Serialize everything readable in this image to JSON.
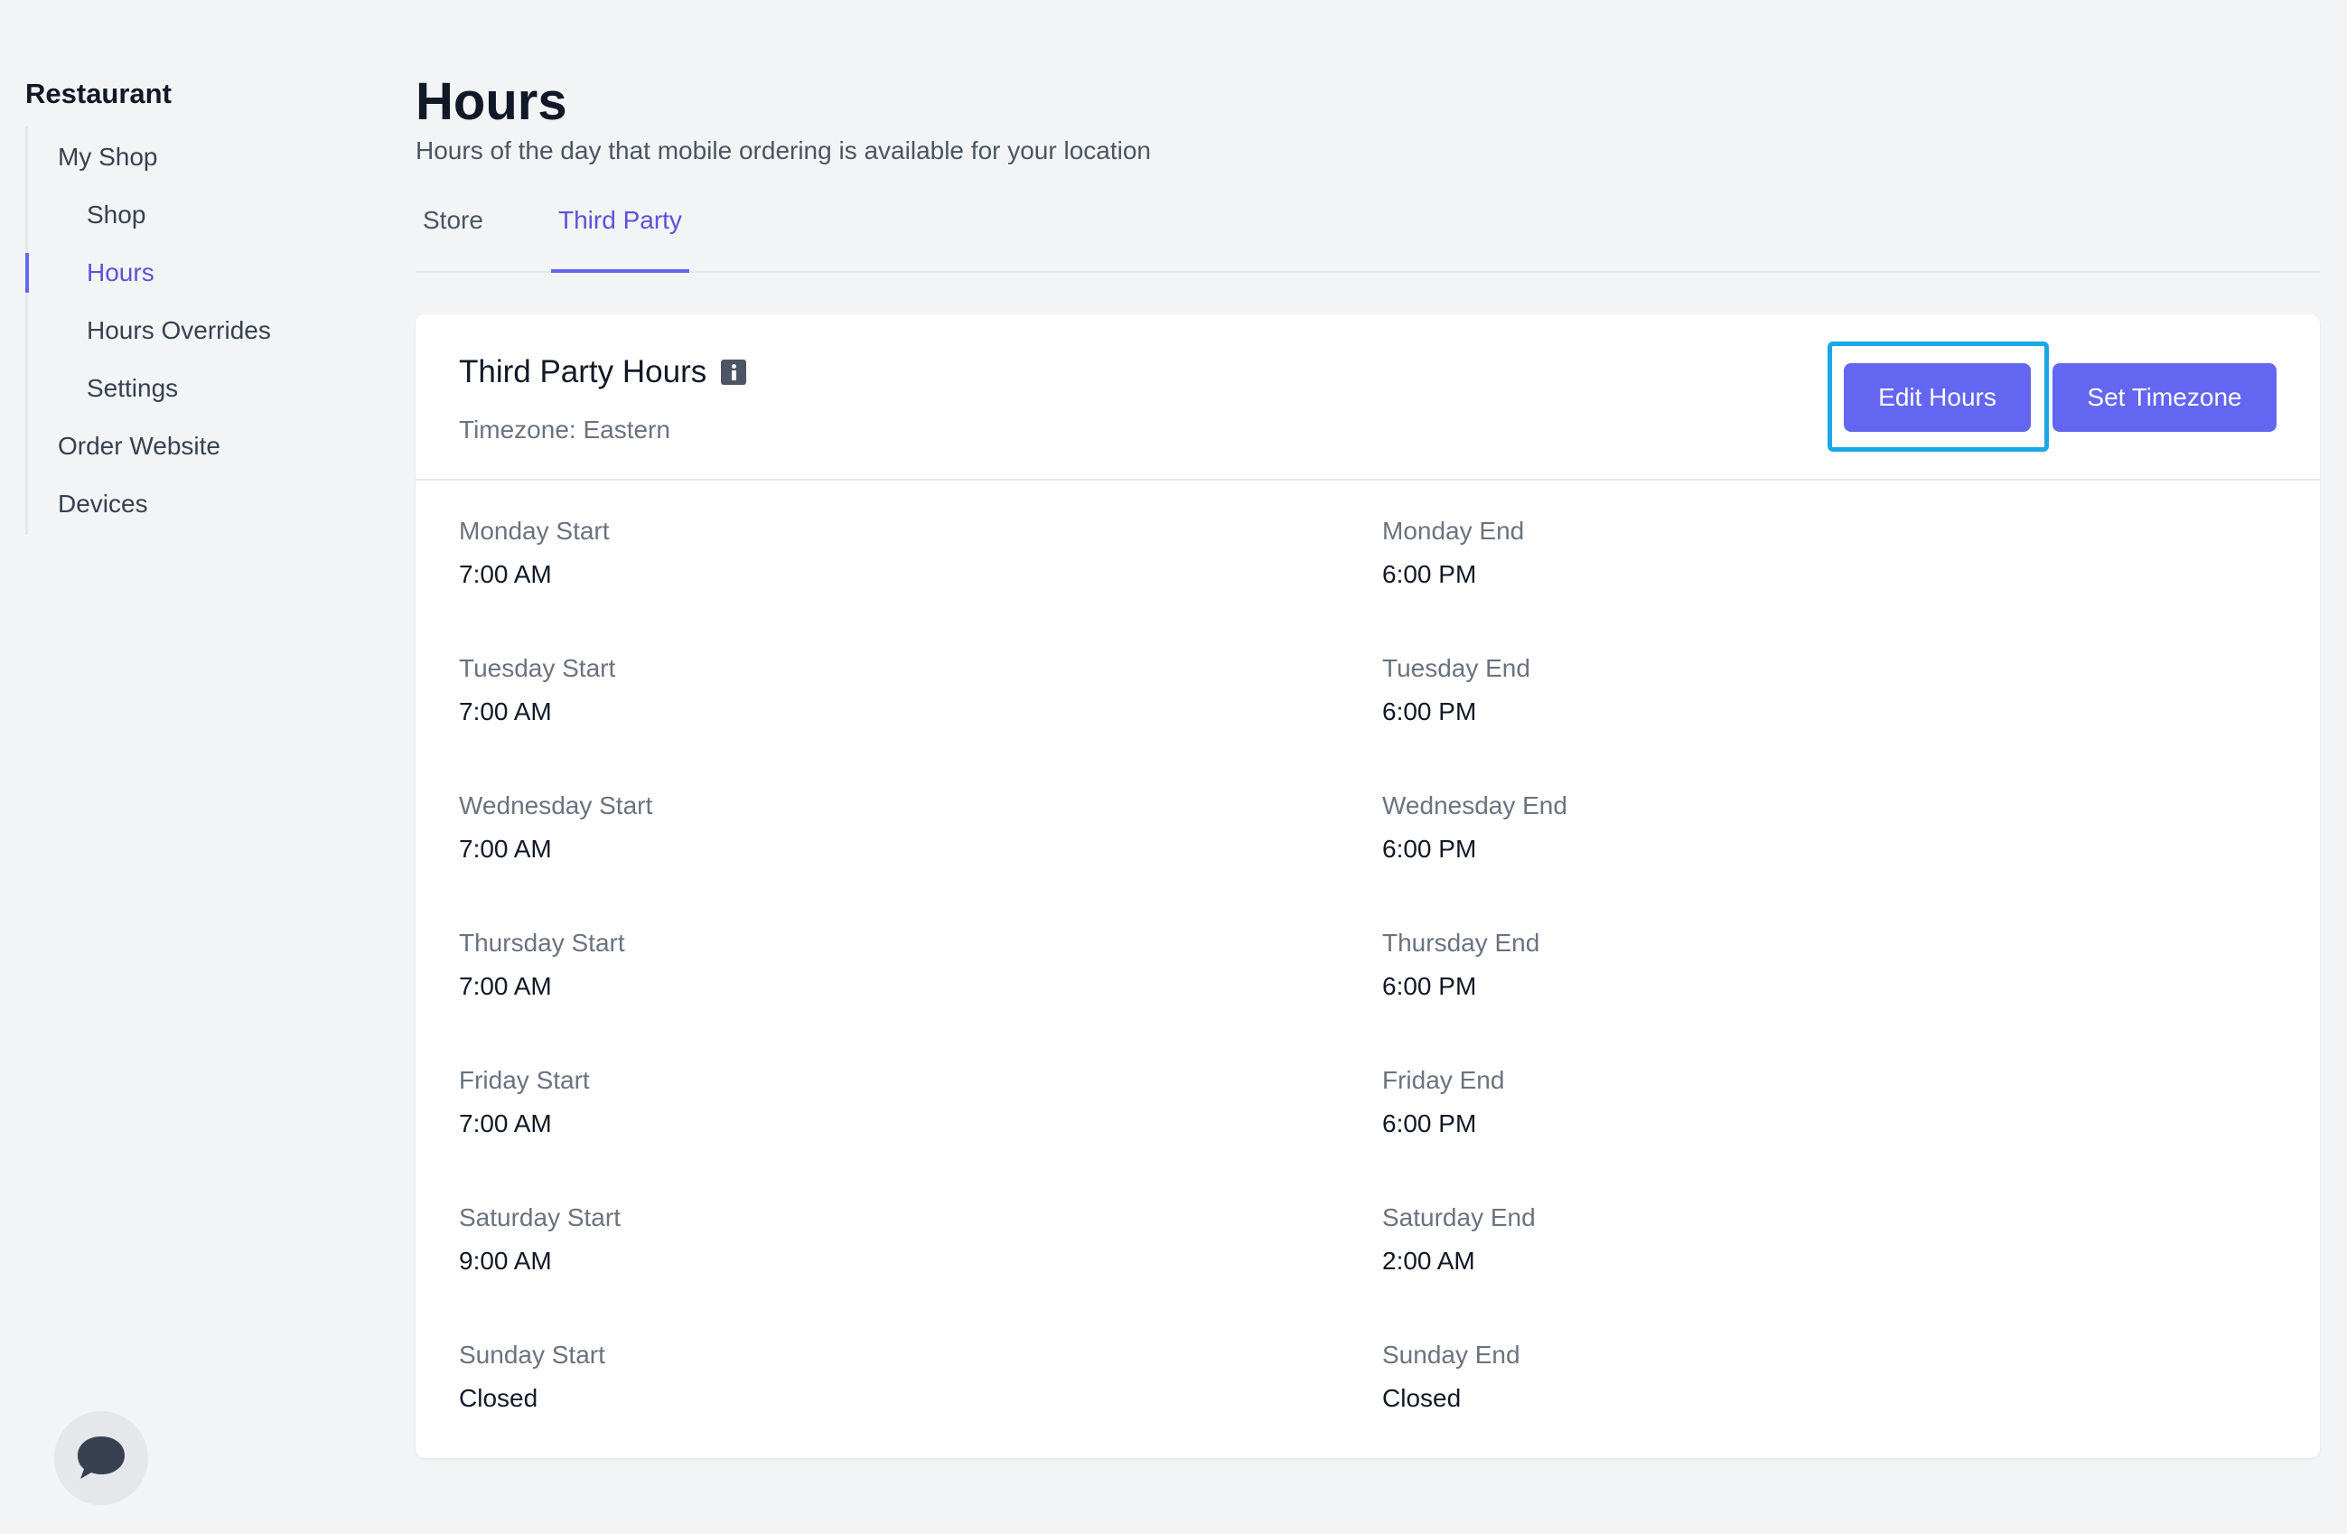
{
  "sidebar": {
    "title": "Restaurant",
    "items": [
      {
        "label": "My Shop"
      },
      {
        "label": "Shop"
      },
      {
        "label": "Hours"
      },
      {
        "label": "Hours Overrides"
      },
      {
        "label": "Settings"
      },
      {
        "label": "Order Website"
      },
      {
        "label": "Devices"
      }
    ],
    "active_item": "Hours"
  },
  "header": {
    "title": "Hours",
    "subtitle": "Hours of the day that mobile ordering is available for your location"
  },
  "tabs": [
    {
      "label": "Store"
    },
    {
      "label": "Third Party"
    }
  ],
  "active_tab": "Third Party",
  "card": {
    "title": "Third Party Hours",
    "timezone": "Timezone: Eastern",
    "edit_button": "Edit Hours",
    "timezone_button": "Set Timezone"
  },
  "hours": [
    {
      "start_label": "Monday Start",
      "start_value": "7:00 AM",
      "end_label": "Monday End",
      "end_value": "6:00 PM"
    },
    {
      "start_label": "Tuesday Start",
      "start_value": "7:00 AM",
      "end_label": "Tuesday End",
      "end_value": "6:00 PM"
    },
    {
      "start_label": "Wednesday Start",
      "start_value": "7:00 AM",
      "end_label": "Wednesday End",
      "end_value": "6:00 PM"
    },
    {
      "start_label": "Thursday Start",
      "start_value": "7:00 AM",
      "end_label": "Thursday End",
      "end_value": "6:00 PM"
    },
    {
      "start_label": "Friday Start",
      "start_value": "7:00 AM",
      "end_label": "Friday End",
      "end_value": "6:00 PM"
    },
    {
      "start_label": "Saturday Start",
      "start_value": "9:00 AM",
      "end_label": "Saturday End",
      "end_value": "2:00 AM"
    },
    {
      "start_label": "Sunday Start",
      "start_value": "Closed",
      "end_label": "Sunday End",
      "end_value": "Closed"
    }
  ],
  "icons": {
    "info": "info-icon",
    "chat": "chat-bubble-icon"
  },
  "colors": {
    "accent": "#6366f1",
    "highlight": "#1aa7e6",
    "background": "#f3f4f6"
  }
}
